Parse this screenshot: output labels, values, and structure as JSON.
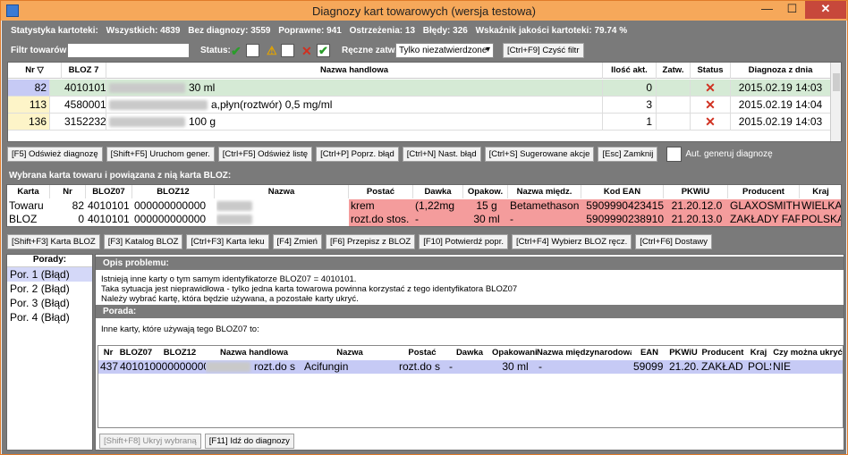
{
  "window": {
    "title": "Diagnozy kart towarowych (wersja testowa)",
    "min": "—",
    "max": "☐",
    "close": "✕"
  },
  "stats": {
    "items": [
      "Statystyka kartoteki:",
      "Wszystkich: 4839",
      "Bez diagnozy: 3559",
      "Poprawne: 941",
      "Ostrzeżenia: 13",
      "Błędy: 326",
      "Wskaźnik jakości kartoteki: 79.74 %"
    ]
  },
  "filter": {
    "label": "Filtr towarów:",
    "value": "",
    "status_label": "Status:",
    "manual_label": "Ręczne zatw.:",
    "manual_value": "Tylko niezatwierdzone",
    "clear_button": "[Ctrl+F9] Czyść filtr"
  },
  "grid1": {
    "headers": [
      "Nr",
      "BLOZ 7",
      "Nazwa handlowa",
      "Ilość akt.",
      "Zatw.",
      "Status",
      "Diagnoza z dnia"
    ],
    "rows": [
      {
        "nr": "82",
        "bloz": "4010101",
        "nazwa": "30 ml",
        "ilosc": "0",
        "zatw": "",
        "status": "✕",
        "data": "2015.02.19 14:03"
      },
      {
        "nr": "113",
        "bloz": "4580001",
        "nazwa": "a,płyn(roztwór) 0,5 mg/ml",
        "ilosc": "3",
        "zatw": "",
        "status": "✕",
        "data": "2015.02.19 14:04"
      },
      {
        "nr": "136",
        "bloz": "3152232",
        "nazwa": "100 g",
        "ilosc": "1",
        "zatw": "",
        "status": "✕",
        "data": "2015.02.19 14:03"
      }
    ]
  },
  "actions1": [
    "[F5] Odśwież diagnozę",
    "[Shift+F5] Uruchom gener.",
    "[Ctrl+F5] Odśwież listę",
    "[Ctrl+P] Poprz. błąd",
    "[Ctrl+N] Nast. błąd",
    "[Ctrl+S] Sugerowane akcje",
    "[Esc] Zamknij"
  ],
  "auto_gen_label": "Aut. generuj diagnozę",
  "section2_title": "Wybrana karta towaru i powiązana z nią karta BLOZ:",
  "grid2": {
    "headers": [
      "Karta",
      "Nr",
      "BLOZ07",
      "BLOZ12",
      "Nazwa",
      "Postać",
      "Dawka",
      "Opakow.",
      "Nazwa międz.",
      "Kod EAN",
      "PKWiU",
      "Producent",
      "Kraj"
    ],
    "rows": [
      {
        "karta": "Towaru",
        "nr": "82",
        "bloz07": "4010101",
        "bloz12": "000000000000",
        "postac": "krem",
        "dawka": "(1,22mg",
        "opak": "15 g",
        "miedz": "Betamethason",
        "ean": "5909990423415",
        "pkwiu": "21.20.12.0",
        "prod": "GLAXOSMITH",
        "kraj": "WIELKA B"
      },
      {
        "karta": "BLOZ",
        "nr": "0",
        "bloz07": "4010101",
        "bloz12": "000000000000",
        "postac": "rozt.do stos.",
        "dawka": "-",
        "opak": "30 ml",
        "miedz": "-",
        "ean": "5909990238910",
        "pkwiu": "21.20.13.0",
        "prod": "ZAKŁADY FAR",
        "kraj": "POLSKA"
      }
    ]
  },
  "actions2": [
    "[Shift+F3] Karta BLOZ",
    "[F3] Katalog BLOZ",
    "[Ctrl+F3] Karta leku",
    "[F4] Zmień",
    "[F6] Przepisz z BLOZ",
    "[F10] Potwierdź popr.",
    "[Ctrl+F4] Wybierz BLOZ ręcz.",
    "[Ctrl+F6] Dostawy"
  ],
  "porady": {
    "header": "Porady:",
    "items": [
      "Por. 1 (Błąd)",
      "Por. 2 (Błąd)",
      "Por. 3 (Błąd)",
      "Por. 4 (Błąd)"
    ]
  },
  "problem": {
    "header": "Opis problemu:",
    "lines": [
      "Istnieją inne karty o tym samym identyfikatorze BLOZ07 = 4010101.",
      "Taka sytuacja jest nieprawidłowa - tylko jedna karta towarowa powinna korzystać z tego identyfikatora BLOZ07",
      "Należy wybrać kartę, która będzie używana, a pozostałe karty ukryć."
    ]
  },
  "advice": {
    "header": "Porada:",
    "text": "Inne karty, które używają tego BLOZ07 to:"
  },
  "grid3": {
    "headers": [
      "Nr",
      "BLOZ07",
      "BLOZ12",
      "Nazwa handlowa",
      "Nazwa",
      "Postać",
      "Dawka",
      "Opakowanie",
      "Nazwa międzynarodowa",
      "EAN",
      "PKWiU",
      "Producent",
      "Kraj",
      "Czy można ukryć"
    ],
    "row": {
      "nr": "437",
      "bloz07": "401010",
      "bloz12": "000000000",
      "nazwa_h": "rozt.do s",
      "nazwa": "Acifungin",
      "postac": "rozt.do s",
      "dawka": "-",
      "opak": "30 ml",
      "miedz": "-",
      "ean": "59099",
      "pkwiu": "21.20.",
      "prod": "ZAKŁAD",
      "kraj": "POLS",
      "ukryc": "NIE"
    }
  },
  "actions3": [
    "[Shift+F8] Ukryj wybraną",
    "[F11] Idź do diagnozy"
  ]
}
